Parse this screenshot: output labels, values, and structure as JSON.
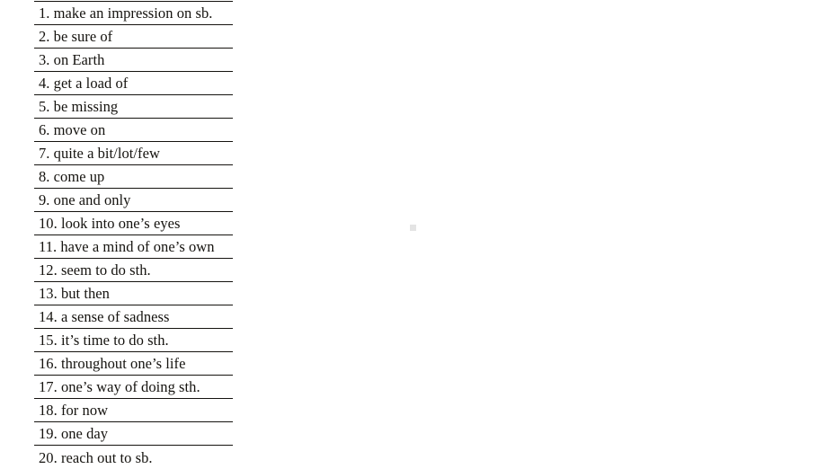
{
  "document": {
    "background_color": "#ffffff",
    "text_color": "#15130f",
    "rule_color": "#15130f"
  },
  "phrase_list": {
    "name": "numbered-phrase-list",
    "items": [
      "1. make an impression on sb.",
      "2. be sure of",
      "3. on Earth",
      "4. get a load of",
      "5. be missing",
      "6. move on",
      "7. quite a bit/lot/few",
      "8. come up",
      "9. one and only",
      "10. look into one’s eyes",
      "11. have a mind of one’s own",
      "12. seem to do sth.",
      "13. but then",
      "14. a sense of sadness",
      "15. it’s time to do sth.",
      "16. throughout one’s life",
      "17. one’s way of doing sth.",
      "18. for now",
      "19. one day",
      "20. reach out to sb."
    ]
  },
  "artifact": {
    "name": "grey-square-artifact",
    "color": "#e4e4e4"
  }
}
